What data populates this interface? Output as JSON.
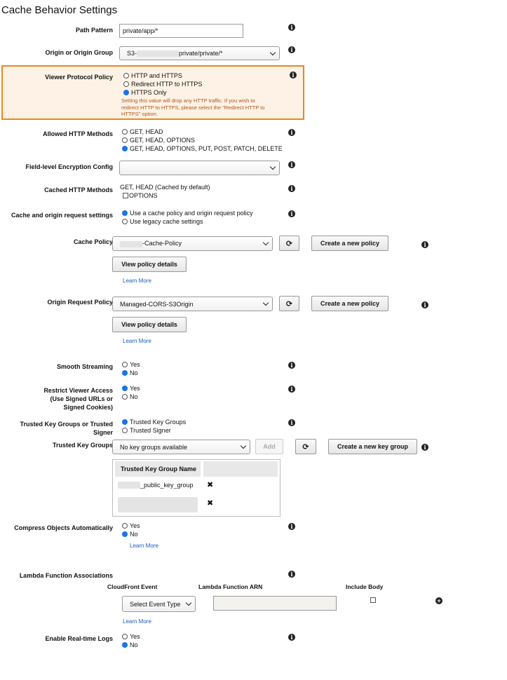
{
  "page": {
    "title": "Cache Behavior Settings"
  },
  "icons": {
    "info": "info-icon",
    "refresh": "refresh-icon",
    "remove": "close-icon",
    "add": "plus-circle-icon",
    "dropdown": "chevron-down-icon"
  },
  "colors": {
    "accent_blue": "#1a73e8",
    "warning_border": "#e8891c",
    "warning_bg": "#fdf2e5",
    "link": "#1a5cb8"
  },
  "path_pattern": {
    "label": "Path Pattern",
    "value": "private/app/*"
  },
  "origin": {
    "label": "Origin or Origin Group",
    "value_prefix": "S3-",
    "value_suffix": "private/private/*"
  },
  "viewer_protocol": {
    "label": "Viewer Protocol Policy",
    "options": [
      "HTTP and HTTPS",
      "Redirect HTTP to HTTPS",
      "HTTPS Only"
    ],
    "selected": "HTTPS Only",
    "note": "Setting this value will drop any HTTP traffic. If you wish to redirect HTTP to HTTPS, please select the \"Redirect HTTP to HTTPS\" option."
  },
  "allowed_methods": {
    "label": "Allowed HTTP Methods",
    "options": [
      "GET, HEAD",
      "GET, HEAD, OPTIONS",
      "GET, HEAD, OPTIONS, PUT, POST, PATCH, DELETE"
    ],
    "selected": "GET, HEAD, OPTIONS, PUT, POST, PATCH, DELETE"
  },
  "field_encryption": {
    "label": "Field-level Encryption Config",
    "value": ""
  },
  "cached_methods": {
    "label": "Cached HTTP Methods",
    "text": "GET, HEAD (Cached by default)",
    "option": "OPTIONS"
  },
  "cache_settings": {
    "label": "Cache and origin request settings",
    "options": [
      "Use a cache policy and origin request policy",
      "Use legacy cache settings"
    ],
    "selected": "Use a cache policy and origin request policy"
  },
  "cache_policy": {
    "label": "Cache Policy",
    "value_suffix": "-Cache-Policy",
    "create_label": "Create a new policy",
    "view_label": "View policy details",
    "learn_more": "Learn More"
  },
  "origin_request_policy": {
    "label": "Origin Request Policy",
    "value": "Managed-CORS-S3Origin",
    "create_label": "Create a new policy",
    "view_label": "View policy details",
    "learn_more": "Learn More"
  },
  "smooth_streaming": {
    "label": "Smooth Streaming",
    "options": [
      "Yes",
      "No"
    ],
    "selected": "No"
  },
  "restrict_viewer": {
    "label_lines": [
      "Restrict Viewer Access",
      "(Use Signed URLs or",
      "Signed Cookies)"
    ],
    "options": [
      "Yes",
      "No"
    ],
    "selected": "Yes"
  },
  "trusted_or_signer": {
    "label_lines": [
      "Trusted Key Groups or Trusted",
      "Signer"
    ],
    "options": [
      "Trusted Key Groups",
      "Trusted Signer"
    ],
    "selected": "Trusted Key Groups"
  },
  "trusted_key_groups": {
    "label": "Trusted Key Groups",
    "select_value": "No key groups available",
    "add_label": "Add",
    "create_label": "Create a new key group",
    "table_header": "Trusted Key Group Name",
    "rows": [
      "_public_key_group",
      ""
    ]
  },
  "compress": {
    "label": "Compress Objects Automatically",
    "options": [
      "Yes",
      "No"
    ],
    "selected": "No",
    "learn_more": "Learn More"
  },
  "lambda": {
    "label": "Lambda Function Associations",
    "columns": [
      "CloudFront Event",
      "Lambda Function ARN",
      "Include Body"
    ],
    "event_select": "Select Event Type",
    "arn_value": "",
    "learn_more": "Learn More"
  },
  "realtime_logs": {
    "label": "Enable Real-time Logs",
    "options": [
      "Yes",
      "No"
    ],
    "selected": "No"
  }
}
